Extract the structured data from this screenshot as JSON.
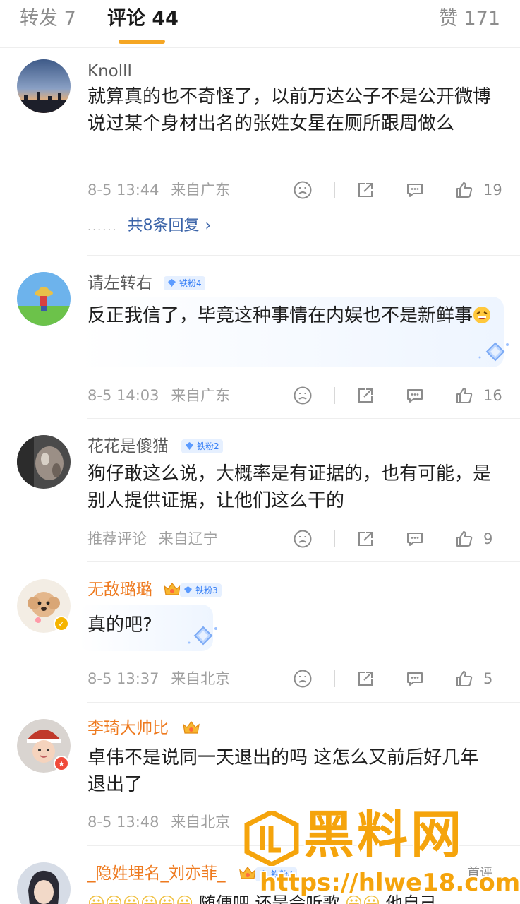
{
  "tabs": {
    "repost": "转发 7",
    "comments": "评论 44",
    "likes": "赞 171"
  },
  "colors": {
    "accent": "#f5a623",
    "link": "#3a63a8",
    "vip_name": "#ee7a1f",
    "fan_badge": "#3b82f6",
    "watermark": "#f5a40c"
  },
  "comments": [
    {
      "username": "Knolll",
      "text": "就算真的也不奇怪了，以前万达公子不是公开微博说过某个身材出名的张姓女星在厕所跟周做么",
      "time": "8-5 13:44",
      "location": "来自广东",
      "likes": "19",
      "replies_label": "共8条回复",
      "avatar_icon": "sunset-skyline-avatar"
    },
    {
      "username": "请左转右",
      "fan_badge": "铁粉4",
      "text": "反正我信了，毕竟这种事情在内娱也不是新鲜事",
      "time": "8-5 14:03",
      "location": "来自广东",
      "likes": "16",
      "avatar_icon": "straw-hat-character-avatar"
    },
    {
      "username": "花花是傻猫",
      "fan_badge": "铁粉2",
      "text": "狗仔敢这么说，大概率是有证据的，也有可能，是别人提供证据，让他们这么干的",
      "time": "推荐评论",
      "location": "来自辽宁",
      "likes": "9",
      "avatar_icon": "cat-photo-avatar"
    },
    {
      "username": "无敌璐璐",
      "fan_badge": "铁粉3",
      "text": "真的吧?",
      "time": "8-5 13:37",
      "location": "来自北京",
      "likes": "5",
      "avatar_icon": "poodle-avatar"
    },
    {
      "username": "李琦大帅比",
      "text": "卓伟不是说同一天退出的吗 这怎么又前后好几年退出了",
      "time": "8-5 13:48",
      "location": "来自北京",
      "avatar_icon": "child-christmas-hat-avatar"
    },
    {
      "username": "_隐姓埋名_刘亦菲_",
      "fan_badge": "铁粉4",
      "text": "随便吧 还是会听歌",
      "text_tail": "他自己",
      "avatar_icon": "person-photo-avatar"
    }
  ],
  "watermark": {
    "title": "黑料网",
    "url": "https://hlwe18.com",
    "sub": "首评"
  }
}
